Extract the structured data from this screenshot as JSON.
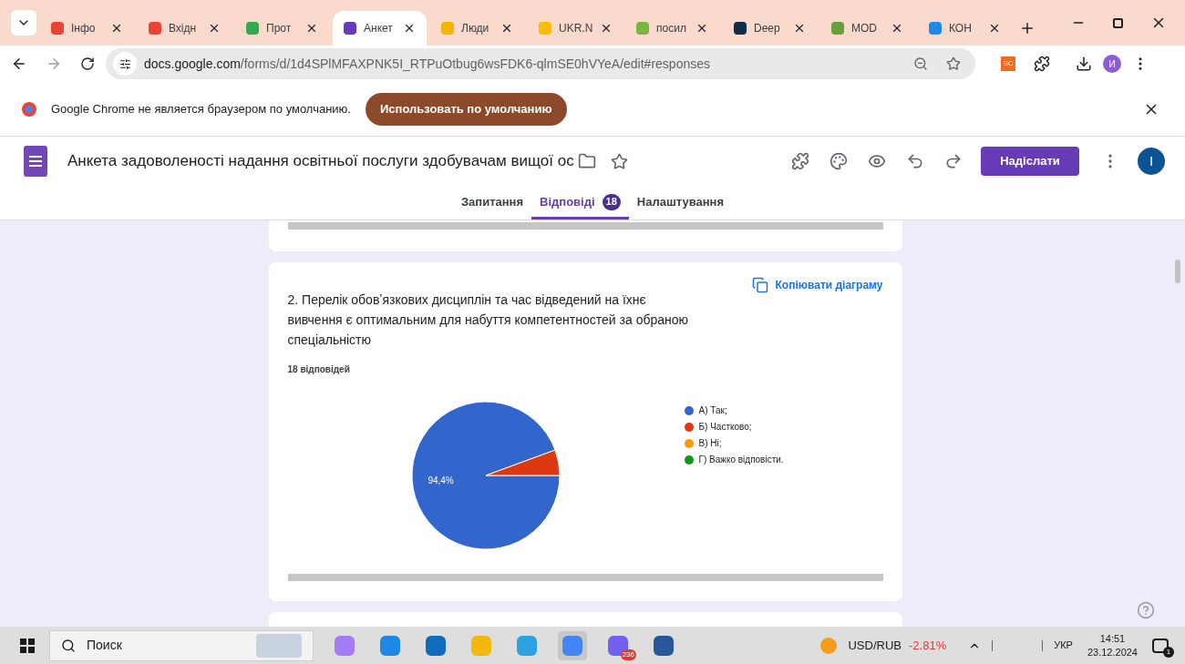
{
  "browser_tabs": [
    {
      "label": "Інфо",
      "selected": false
    },
    {
      "label": "Вхідн",
      "selected": false
    },
    {
      "label": "Прот",
      "selected": false
    },
    {
      "label": "Анкет",
      "selected": true
    },
    {
      "label": "Люди",
      "selected": false
    },
    {
      "label": "UKR.N",
      "selected": false
    },
    {
      "label": "посил",
      "selected": false
    },
    {
      "label": "Deep",
      "selected": false
    },
    {
      "label": "MOD",
      "selected": false
    },
    {
      "label": "КОН",
      "selected": false
    }
  ],
  "address_bar": {
    "host": "docs.google.com",
    "path": "/forms/d/1d4SPlMFAXPNK5I_RTPuOtbug6wsFDK6-qlmSE0hVYeA/edit#responses"
  },
  "extensions": {
    "sc_badge": "SC",
    "profile_initial": "И"
  },
  "info_bar": {
    "message": "Google Chrome не является браузером по умолчанию.",
    "button": "Использовать по умолчанию"
  },
  "form_header": {
    "title": "Анкета задоволеності надання освітньої послуги здобувачам вищої ос",
    "send_button": "Надіслати",
    "avatar_initial": "I"
  },
  "form_tabs": [
    {
      "label": "Запитання",
      "selected": false
    },
    {
      "label": "Відповіді",
      "selected": true,
      "badge": "18"
    },
    {
      "label": "Налаштування",
      "selected": false
    }
  ],
  "question_card": {
    "copy_chart": "Копіювати діаграму",
    "question": "2. Перелік обовʼязкових дисциплін та час відведений на їхнє вивчення є оптимальним для набуття компетентностей за обраною спеціальністю",
    "responses_count": "18 відповідей",
    "legend_separators": [
      ";",
      ";",
      ";"
    ],
    "chart_data": {
      "type": "pie",
      "categories": [
        "А) Так",
        "Б) Частково",
        "В) Ні",
        "Г) Важко відповісти."
      ],
      "values": [
        94.4,
        5.6,
        0,
        0
      ],
      "colors": [
        "#3366cc",
        "#dc3912",
        "#ff9900",
        "#109618"
      ],
      "value_labels": [
        "94,4%",
        null,
        null,
        null
      ]
    }
  },
  "taskbar": {
    "search_placeholder": "Поиск",
    "viber_badge": "236",
    "ticker": "USD/RUB",
    "ticker_change": "-2.81%",
    "language": "УКР",
    "time": "14:51",
    "date": "23.12.2024",
    "notification_badge": "1"
  }
}
